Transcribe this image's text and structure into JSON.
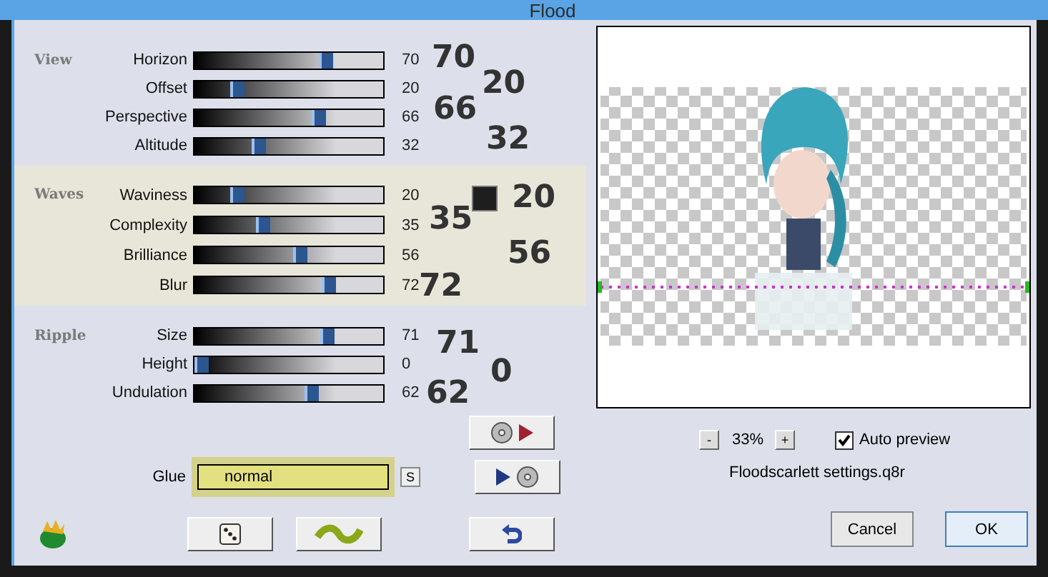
{
  "window": {
    "title": "Flood"
  },
  "groups": [
    {
      "label": "View",
      "highlighted": false,
      "sliders": [
        {
          "label": "Horizon",
          "level": 0.7,
          "reading": "70"
        },
        {
          "label": "Offset",
          "level": 0.2,
          "reading": "20"
        },
        {
          "label": "Perspective",
          "level": 0.66,
          "reading": "66"
        },
        {
          "label": "Altitude",
          "level": 0.32,
          "reading": "32"
        }
      ]
    },
    {
      "label": "Waves",
      "highlighted": true,
      "sliders": [
        {
          "label": "Waviness",
          "level": 0.2,
          "reading": "20"
        },
        {
          "label": "Complexity",
          "level": 0.35,
          "reading": "35"
        },
        {
          "label": "Brilliance",
          "level": 0.56,
          "reading": "56"
        },
        {
          "label": "Blur",
          "level": 0.72,
          "reading": "72"
        }
      ]
    },
    {
      "label": "Ripple",
      "highlighted": false,
      "sliders": [
        {
          "label": "Size",
          "level": 0.71,
          "reading": "71"
        },
        {
          "label": "Height",
          "level": 0.0,
          "reading": "0"
        },
        {
          "label": "Undulation",
          "level": 0.62,
          "reading": "62"
        }
      ]
    }
  ],
  "swatch": {
    "color": "#1e1e1e"
  },
  "annotations": [
    "70",
    "20",
    "66",
    "32",
    "35",
    "20",
    "56",
    "72",
    "71",
    "0",
    "62"
  ],
  "glue": {
    "label": "Glue",
    "value": "normal",
    "button": "S"
  },
  "preview": {
    "zoom_out": "-",
    "zoom": "33%",
    "zoom_in": "+",
    "auto_preview": {
      "label": "Auto preview",
      "checked": true
    }
  },
  "settings_file": "Floodscarlett settings.q8r",
  "buttons": [
    {
      "label": "Cancel",
      "default": false
    },
    {
      "label": "OK",
      "default": true
    }
  ]
}
